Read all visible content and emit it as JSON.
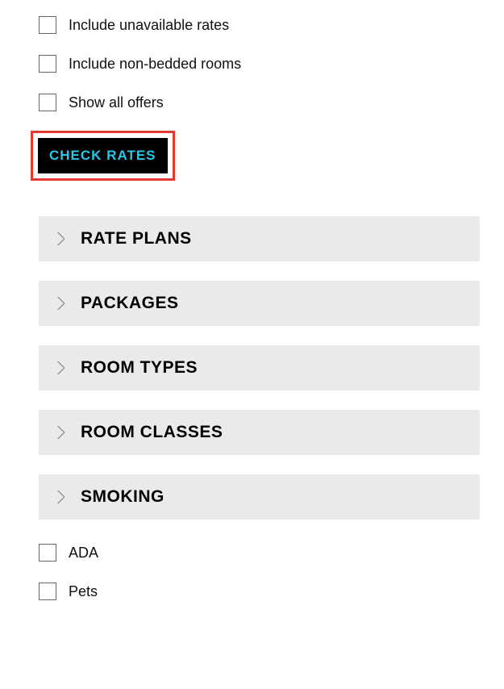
{
  "options_top": {
    "include_unavailable": "Include unavailable rates",
    "include_non_bedded": "Include non-bedded rooms",
    "show_all_offers": "Show all offers"
  },
  "check_rates_label": "CHECK RATES",
  "accordions": {
    "rate_plans": "RATE PLANS",
    "packages": "PACKAGES",
    "room_types": "ROOM TYPES",
    "room_classes": "ROOM CLASSES",
    "smoking": "SMOKING"
  },
  "options_bottom": {
    "ada": "ADA",
    "pets": "Pets"
  }
}
